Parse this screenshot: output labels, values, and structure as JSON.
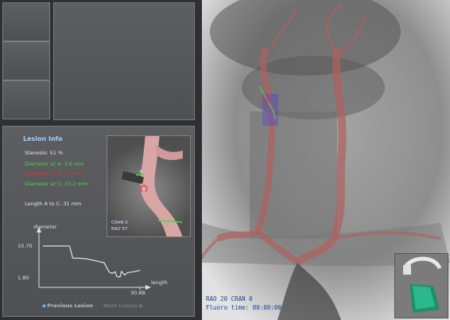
{
  "lesion_info": {
    "title": "Lesion Info",
    "stenosis": "Stenosis:  51 %",
    "diameter_a": "Diameter at A:  3.6 mm",
    "diameter_b": "Diameter at B:  1.8 mm",
    "diameter_c": "Diameter at C:  10.2 mm",
    "length": "Length A to C: 31 mm"
  },
  "mini_view": {
    "label_a": "A",
    "label_b": "B",
    "label_c": "C",
    "angle_line1": "CRAN 0",
    "angle_line2": "RAO 57"
  },
  "chart_data": {
    "type": "line",
    "ylabel": "diameter",
    "xlabel": "length",
    "yticks": [
      "10.70",
      "1.80"
    ],
    "x_end_label": "30.88",
    "ylim": [
      1.8,
      10.7
    ],
    "xlim": [
      0,
      30.88
    ],
    "series": [
      {
        "x": [
          0,
          4,
          8,
          8.5,
          9.5,
          10.5,
          11,
          14,
          17.5,
          18.5,
          19.5,
          21,
          22,
          23,
          23.5,
          24.5,
          25,
          26,
          27,
          28.5,
          29.5,
          30.88
        ],
        "values": [
          10.7,
          10.7,
          10.7,
          10.6,
          7.3,
          7.3,
          7.3,
          7.1,
          6.4,
          6.2,
          6.0,
          3.5,
          3.0,
          3.5,
          2.2,
          2.0,
          3.6,
          2.6,
          3.3,
          3.4,
          3.6,
          3.9
        ]
      }
    ]
  },
  "navigation": {
    "previous": "Previous Lesion",
    "next": "Next Lesion"
  },
  "overlay": {
    "line1": "RAO  20  CRAN   0",
    "line2": "Fluoro time:   00:00:00"
  },
  "colors": {
    "title": "#9fd0ff",
    "green": "#52d24c",
    "red": "#e33535",
    "vessel": "#b06060"
  }
}
